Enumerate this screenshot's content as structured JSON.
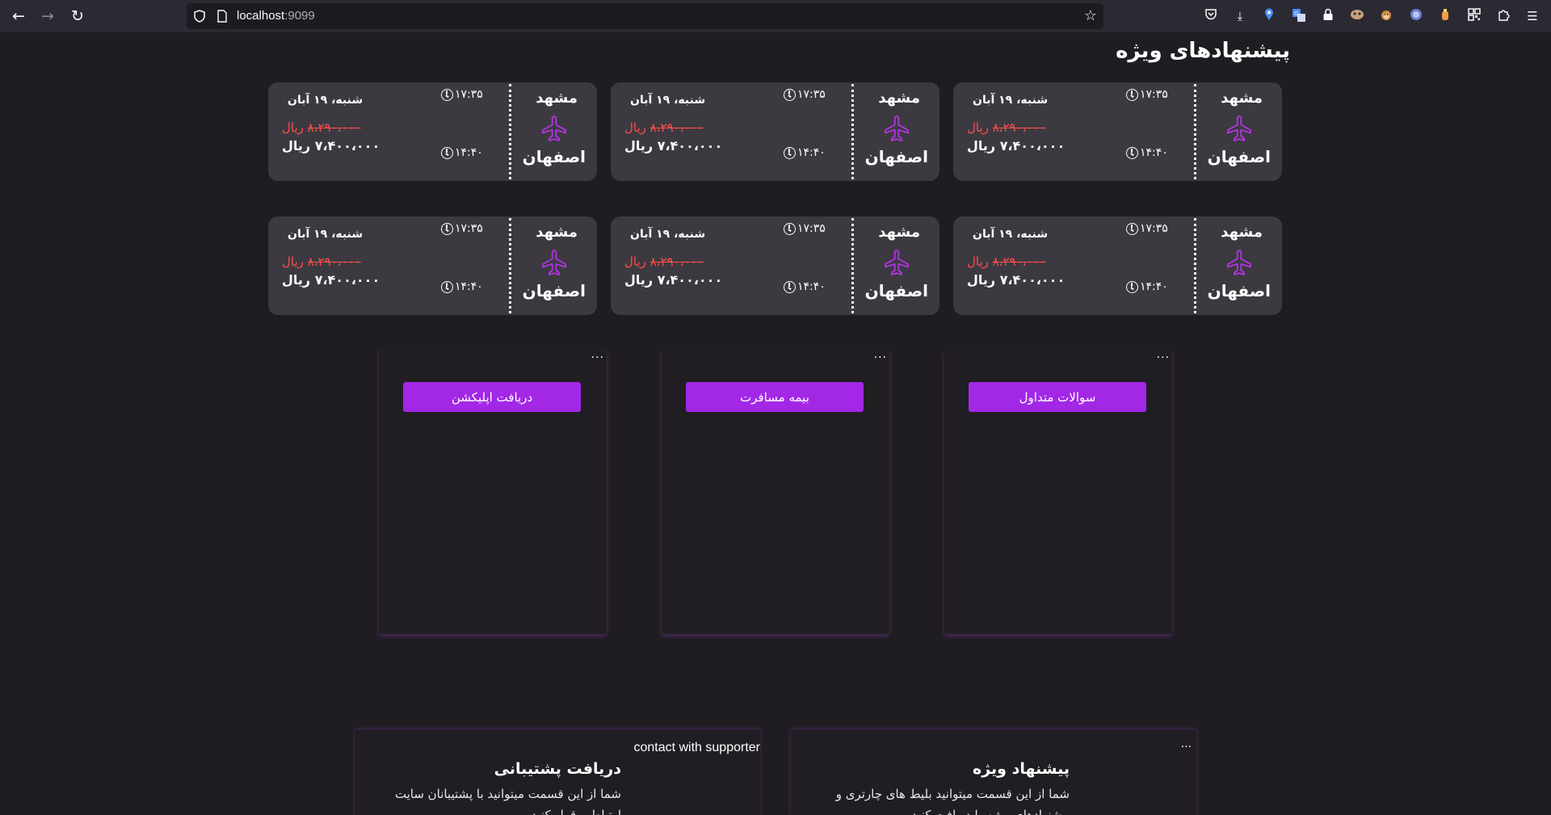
{
  "browser": {
    "url_host": "localhost",
    "url_port": ":9099",
    "icons": {
      "back": "arrow-left-icon",
      "forward": "arrow-right-icon",
      "reload": "reload-icon",
      "shield": "shield-icon",
      "page": "page-icon",
      "bookmark": "star-icon",
      "toolbar": [
        "pocket-icon",
        "download-icon",
        "location-icon",
        "translate-icon",
        "lock-icon",
        "extension-face-icon",
        "extension-monkey-icon",
        "extension-circle-icon",
        "extension-bottle-icon",
        "qr-icon",
        "puzzle-icon",
        "menu-icon"
      ]
    }
  },
  "page": {
    "title": "پیشنهادهای ویژه",
    "accent_color": "#a228e6",
    "ticket_bg": "#3c3a40"
  },
  "tickets": [
    {
      "from": "مشهد",
      "to": "اصفهان",
      "date": "شنبه، ۱۹ آبان",
      "depart_time": "۱۷:۳۵",
      "arrive_time": "۱۴:۴۰",
      "old_price": "۸،۲۹۰،۰۰۰",
      "old_price_unit": "ریال",
      "new_price": "۷،۴۰۰،۰۰۰ ریال"
    },
    {
      "from": "مشهد",
      "to": "اصفهان",
      "date": "شنبه، ۱۹ آبان",
      "depart_time": "۱۷:۳۵",
      "arrive_time": "۱۴:۴۰",
      "old_price": "۸،۲۹۰،۰۰۰",
      "old_price_unit": "ریال",
      "new_price": "۷،۴۰۰،۰۰۰ ریال"
    },
    {
      "from": "مشهد",
      "to": "اصفهان",
      "date": "شنبه، ۱۹ آبان",
      "depart_time": "۱۷:۳۵",
      "arrive_time": "۱۴:۴۰",
      "old_price": "۸،۲۹۰،۰۰۰",
      "old_price_unit": "ریال",
      "new_price": "۷،۴۰۰،۰۰۰ ریال"
    },
    {
      "from": "مشهد",
      "to": "اصفهان",
      "date": "شنبه، ۱۹ آبان",
      "depart_time": "۱۷:۳۵",
      "arrive_time": "۱۴:۴۰",
      "old_price": "۸،۲۹۰،۰۰۰",
      "old_price_unit": "ریال",
      "new_price": "۷،۴۰۰،۰۰۰ ریال"
    },
    {
      "from": "مشهد",
      "to": "اصفهان",
      "date": "شنبه، ۱۹ آبان",
      "depart_time": "۱۷:۳۵",
      "arrive_time": "۱۴:۴۰",
      "old_price": "۸،۲۹۰،۰۰۰",
      "old_price_unit": "ریال",
      "new_price": "۷،۴۰۰،۰۰۰ ریال"
    },
    {
      "from": "مشهد",
      "to": "اصفهان",
      "date": "شنبه، ۱۹ آبان",
      "depart_time": "۱۷:۳۵",
      "arrive_time": "۱۴:۴۰",
      "old_price": "۸،۲۹۰،۰۰۰",
      "old_price_unit": "ریال",
      "new_price": "۷،۴۰۰،۰۰۰ ریال"
    }
  ],
  "service_cards": [
    {
      "menu": "...",
      "button": "دریافت اپلیکشن"
    },
    {
      "menu": "...",
      "button": "بیمه مسافرت"
    },
    {
      "menu": "...",
      "button": "سوالات متداول"
    }
  ],
  "info_cards": {
    "support": {
      "tag": "contact with supporter",
      "heading": "دریافت پشتیبانی",
      "body": "شما از این قسمت میتوانید با پشتیبانان سایت ارتباط برقرار کنید"
    },
    "offer": {
      "menu": "...",
      "heading": "پیشنهاد ویژه",
      "body": "شما از این قسمت میتوانید بلیط های چارتری و پیشنهادهای ویژه را دریافت کنید"
    }
  }
}
